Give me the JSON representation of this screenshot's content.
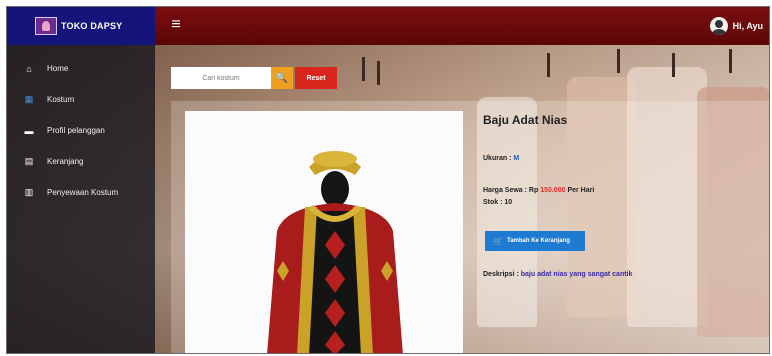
{
  "brand": {
    "name": "TOKO DAPSY",
    "logo_icon": "costume-logo-icon"
  },
  "topbar": {
    "menu_icon": "≡",
    "user_name": "Hi, Ayu"
  },
  "sidebar": {
    "items": [
      {
        "label": "Home",
        "icon": "⌂",
        "icon_name": "home-icon"
      },
      {
        "label": "Kostum",
        "icon": "▦",
        "icon_name": "grid-icon",
        "active": true
      },
      {
        "label": "Profil pelanggan",
        "icon": "▬",
        "icon_name": "user-card-icon"
      },
      {
        "label": "Keranjang",
        "icon": "▤",
        "icon_name": "cart-list-icon"
      },
      {
        "label": "Penyewaan Kostum",
        "icon": "▥",
        "icon_name": "rental-icon"
      }
    ]
  },
  "search": {
    "placeholder": "Cari kostum",
    "button_icon": "🔍",
    "reset_label": "Reset"
  },
  "product": {
    "title": "Baju Adat Nias",
    "size_label": "Ukuran : ",
    "size_value": "M",
    "price_label": "Harga Sewa : Rp ",
    "price_value": "150.000",
    "price_suffix": " Per Hari",
    "stock_label": "Stok : 10",
    "cart_button_label": "Tambah Ke Keranjang",
    "cart_button_icon": "🛒",
    "desc_label": "Deskripsi : ",
    "desc_value": "baju adat nias yang sangat cantik"
  },
  "colors": {
    "topbar": "#6e0b0b",
    "brand": "#14147a",
    "search_button": "#f0a020",
    "reset_button": "#d9261c",
    "cart_button": "#1f7ad1"
  }
}
